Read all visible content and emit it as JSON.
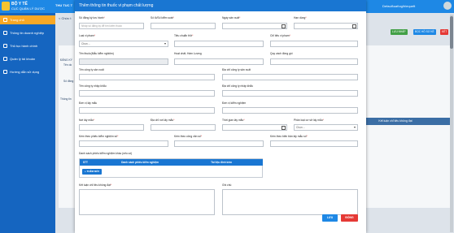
{
  "app": {
    "logo_line1": "BỘ Y TẾ",
    "logo_line2": "CỤC QUẢN LÝ DƯỢC",
    "header_tab": "THU TUC T",
    "user": "Default\\uat\\nglh\\equeft"
  },
  "sidebar": {
    "items": [
      {
        "label": "Trang chủ",
        "icon": "home-icon",
        "active": true
      },
      {
        "label": "Thông tin doanh nghiệp",
        "icon": "building-icon",
        "active": false
      },
      {
        "label": "Thủ tục hành chính",
        "icon": "document-icon",
        "active": false
      },
      {
        "label": "Quản lý tài khoản",
        "icon": "user-icon",
        "active": false
      },
      {
        "label": "Hướng dẫn sử dụng",
        "icon": "help-icon",
        "active": false
      }
    ]
  },
  "background": {
    "tab": "< Chức t",
    "row_label": "Đăng ký",
    "side_labels": [
      "ĐĂNG KÝ",
      "Tên do",
      "Số đăng",
      "Thông tin"
    ],
    "buttons": [
      {
        "label": "LƯU NHÁP",
        "color": "#43a047"
      },
      {
        "label": "ĐỌC HỒ SƠ KÈ",
        "color": "#1e88e5"
      },
      {
        "label": "KÉT",
        "color": "#e53935"
      }
    ],
    "result_bar": "Kết luận chỉ tiêu không đạt"
  },
  "modal": {
    "title": "Thêm thông tin thuốc vi phạm chất lượng",
    "fields": {
      "so_dang_ky": {
        "label": "Số đăng ký lưu hành",
        "required": true,
        "placeholder": "Nhập số đăng ký để tìm kiếm thuốc"
      },
      "so_lo": {
        "label": "Số lô/Số kiểm soát",
        "required": true
      },
      "ngay_san_xuat": {
        "label": "Ngày sản xuất",
        "required": true
      },
      "han_dung": {
        "label": "Hạn dùng",
        "required": true
      },
      "loai_vi_pham": {
        "label": "Loại vi phạm",
        "required": true,
        "value": "Chọn ..."
      },
      "tieu_chuan": {
        "label": "Tiêu chuẩn thử",
        "required": true
      },
      "chi_tieu_vi_pham": {
        "label": "Chỉ tiêu vi phạm",
        "required": true
      },
      "ten_thuoc": {
        "label": "Tên thuốc(Mẫu kiểm nghiệm)"
      },
      "hoat_chat": {
        "label": "Hoạt chất; Hàm Lượng"
      },
      "quy_cach": {
        "label": "Quy cách đóng gói"
      },
      "cty_san_xuat": {
        "label": "Tên công ty sản xuất"
      },
      "dia_chi_san_xuat": {
        "label": "Địa chỉ công ty sản xuất"
      },
      "cty_nhap_khau": {
        "label": "Tên công ty nhập khẩu"
      },
      "dia_chi_nhap_khau": {
        "label": "Địa chỉ công ty nhập khẩu"
      },
      "don_vi_lay_mau": {
        "label": "Đơn vị lấy mẫu"
      },
      "don_vi_kiem_nghiem": {
        "label": "Đơn vị kiểm nghiệm"
      },
      "noi_lay_mau": {
        "label": "Nơi lấy mẫu",
        "required": true
      },
      "dia_chi_noi_lay_mau": {
        "label": "Địa chỉ nơi lấy mẫu",
        "required": true
      },
      "thoi_gian_lay_mau": {
        "label": "Thời gian lấy mẫu",
        "required": true
      },
      "phan_loai_co_so": {
        "label": "Phân loại cơ sở lấy mẫu",
        "required": true,
        "value": "Chọn ..."
      },
      "phieu_kiem_nghiem": {
        "label": "Kèm theo phiếu kiểm nghiệm số",
        "required": true
      },
      "cong_van": {
        "label": "Kèm theo công văn số",
        "required": true
      },
      "bien_ban": {
        "label": "Kèm theo biên bản lấy mẫu số",
        "required": true
      },
      "ket_luan": {
        "label": "Kết luận chỉ tiêu không đạt",
        "required": true
      },
      "ghi_chu": {
        "label": "Ghi chú"
      }
    },
    "table": {
      "title": "Danh sách phiếu kiểm nghiệm khác (nếu có)",
      "headers": [
        "STT",
        "Danh sách phiếu kiểm nghiệm",
        "Tài liệu đính kèm"
      ],
      "add_label": "+ THÊM MỚI"
    },
    "buttons": {
      "save": "LƯU",
      "close": "ĐÓNG"
    },
    "accent_color": "#1976d2"
  }
}
